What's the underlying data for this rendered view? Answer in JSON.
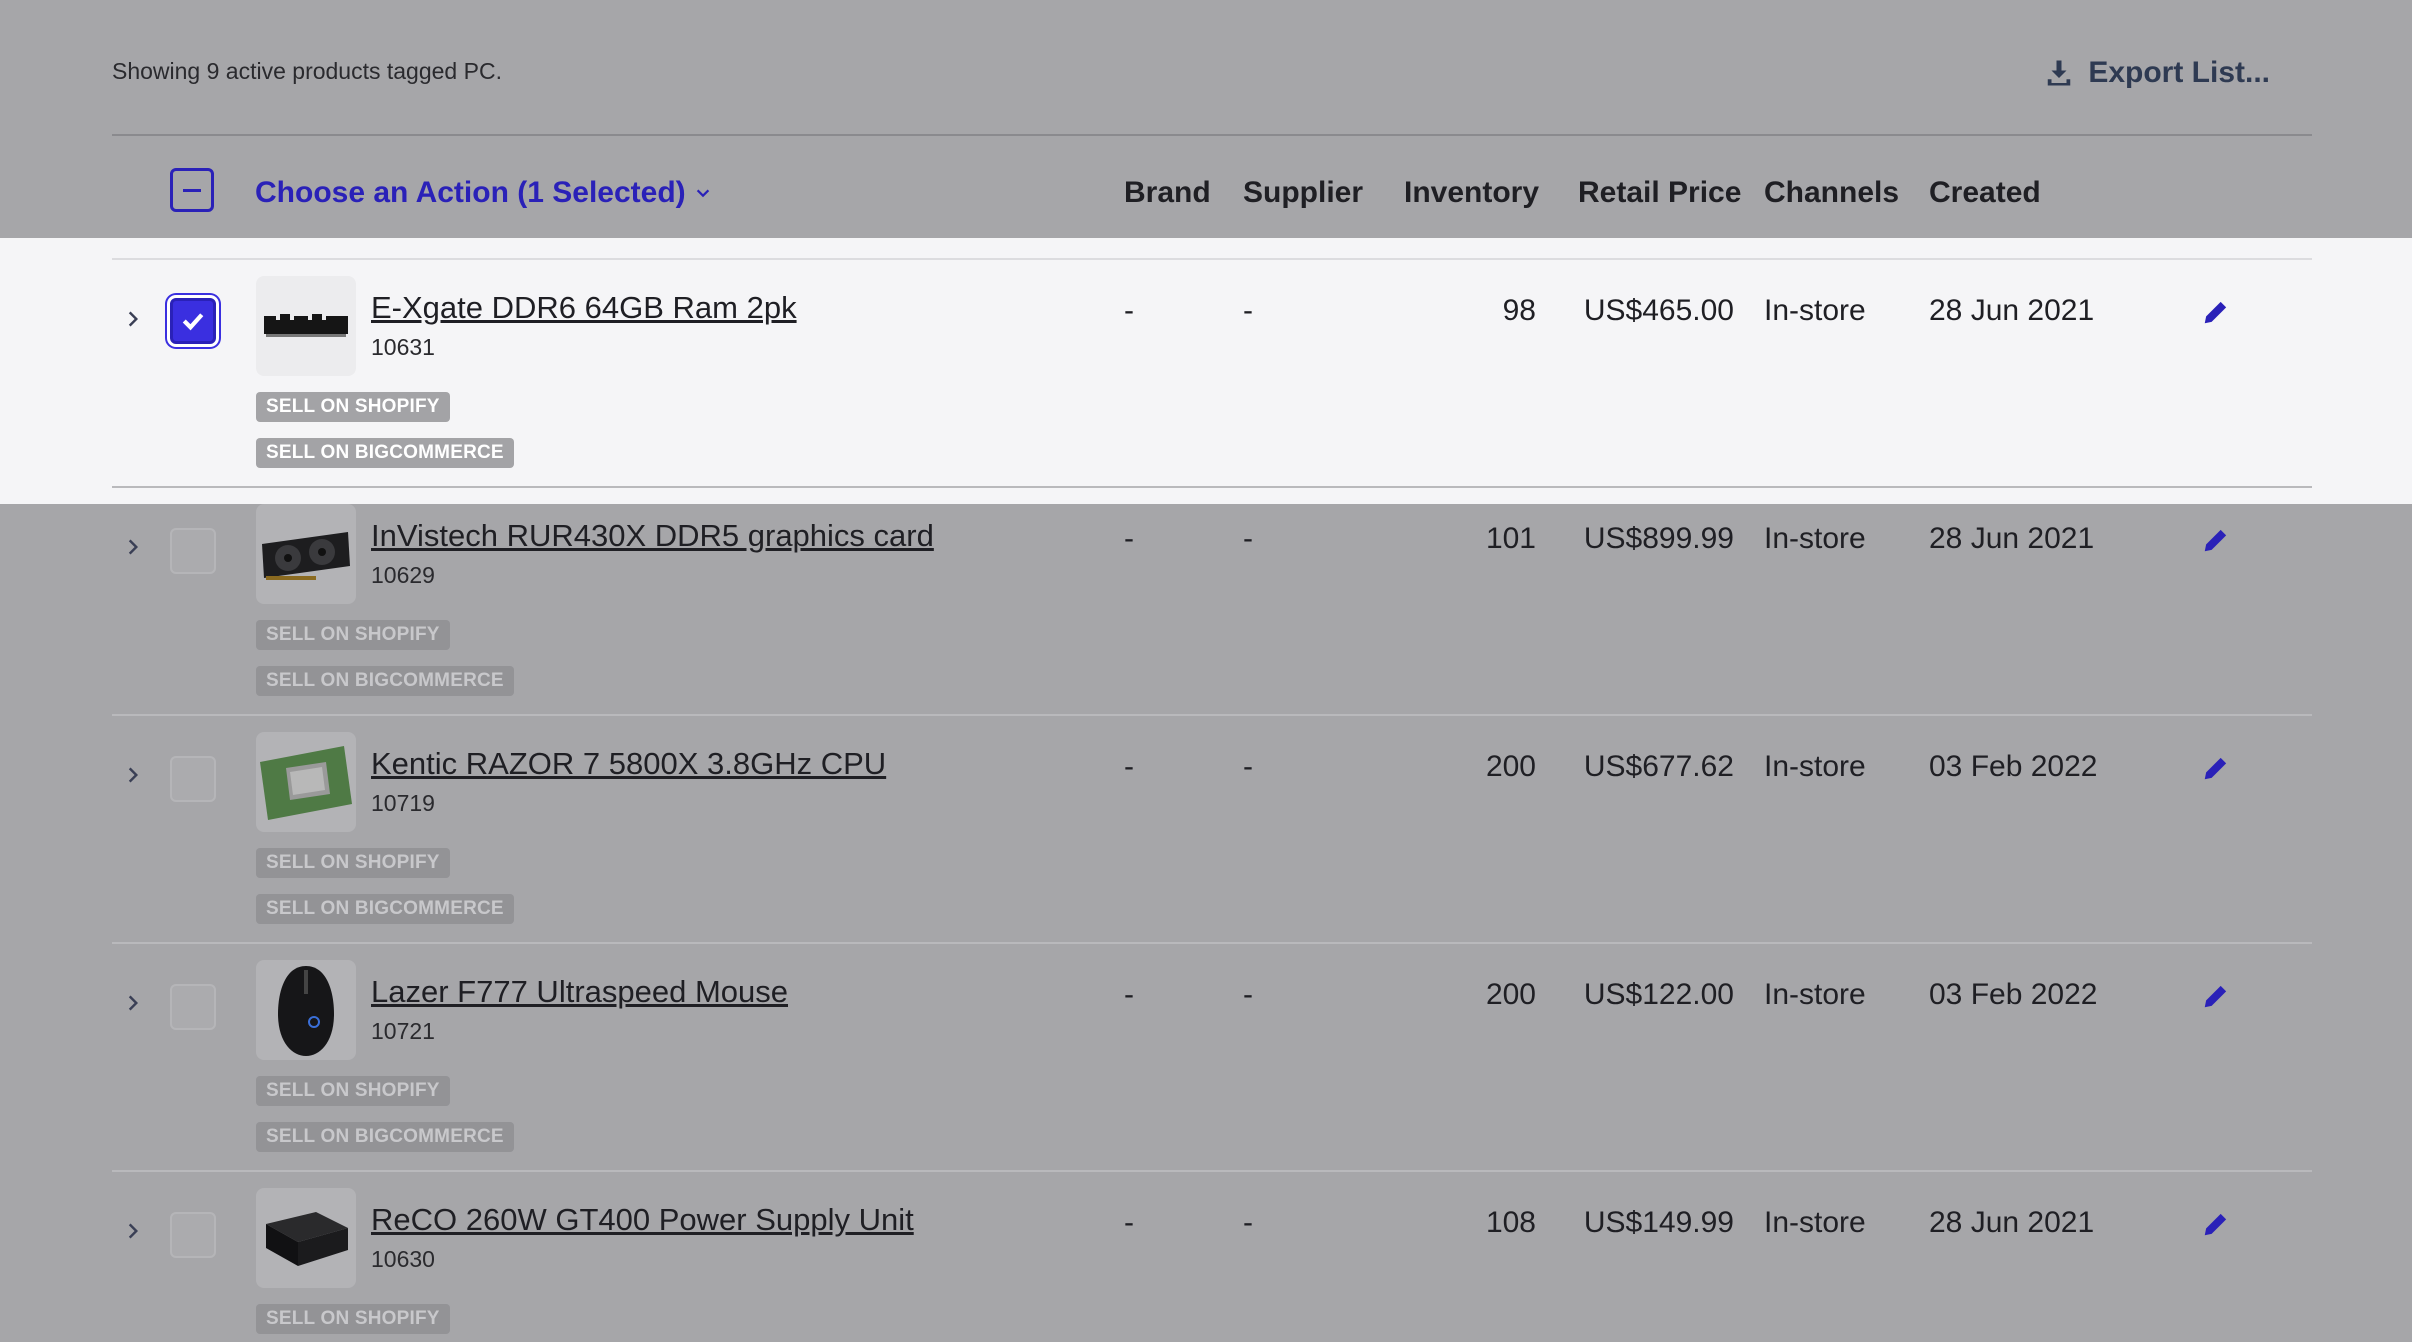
{
  "summary": "Showing 9 active products tagged PC.",
  "export_label": "Export List...",
  "header": {
    "action_label": "Choose an Action (1 Selected)",
    "brand": "Brand",
    "supplier": "Supplier",
    "inventory": "Inventory",
    "retail_price": "Retail Price",
    "channels": "Channels",
    "created": "Created"
  },
  "rows": [
    {
      "name": "E-Xgate DDR6 64GB Ram 2pk",
      "sku": "10631",
      "brand": "-",
      "supplier": "-",
      "inventory": "98",
      "price": "US$465.00",
      "channel": "In-store",
      "created": "28 Jun 2021",
      "selected": true,
      "tags": [
        "SELL ON SHOPIFY",
        "SELL ON BIGCOMMERCE"
      ],
      "image": "ram-image"
    },
    {
      "name": "InVistech RUR430X DDR5 graphics card",
      "sku": "10629",
      "brand": "-",
      "supplier": "-",
      "inventory": "101",
      "price": "US$899.99",
      "channel": "In-store",
      "created": "28 Jun 2021",
      "selected": false,
      "tags": [
        "SELL ON SHOPIFY",
        "SELL ON BIGCOMMERCE"
      ],
      "image": "graphics-card-image"
    },
    {
      "name": "Kentic RAZOR 7 5800X 3.8GHz CPU",
      "sku": "10719",
      "brand": "-",
      "supplier": "-",
      "inventory": "200",
      "price": "US$677.62",
      "channel": "In-store",
      "created": "03 Feb 2022",
      "selected": false,
      "tags": [
        "SELL ON SHOPIFY",
        "SELL ON BIGCOMMERCE"
      ],
      "image": "cpu-image"
    },
    {
      "name": "Lazer F777 Ultraspeed Mouse",
      "sku": "10721",
      "brand": "-",
      "supplier": "-",
      "inventory": "200",
      "price": "US$122.00",
      "channel": "In-store",
      "created": "03 Feb 2022",
      "selected": false,
      "tags": [
        "SELL ON SHOPIFY",
        "SELL ON BIGCOMMERCE"
      ],
      "image": "mouse-image"
    },
    {
      "name": "ReCO 260W GT400 Power Supply Unit",
      "sku": "10630",
      "brand": "-",
      "supplier": "-",
      "inventory": "108",
      "price": "US$149.99",
      "channel": "In-store",
      "created": "28 Jun 2021",
      "selected": false,
      "tags": [
        "SELL ON SHOPIFY"
      ],
      "image": "power-supply-image"
    }
  ],
  "colors": {
    "accent": "#2a21b8",
    "checkbox_fill": "#3a2fe0",
    "backdrop": "#a6a6a9"
  }
}
